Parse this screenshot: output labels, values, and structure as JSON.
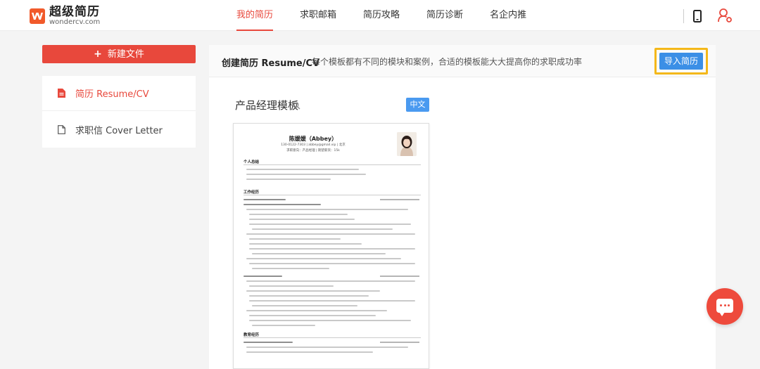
{
  "brand": {
    "title": "超级简历",
    "subtitle": "wondercv.com",
    "accent": "#e8483c",
    "logo_color": "#f15a2b"
  },
  "nav": {
    "items": [
      {
        "label": "我的简历",
        "active": true
      },
      {
        "label": "求职邮箱",
        "active": false
      },
      {
        "label": "简历攻略",
        "active": false
      },
      {
        "label": "简历诊断",
        "active": false
      },
      {
        "label": "名企内推",
        "active": false
      }
    ],
    "icons": [
      "phone-icon",
      "user-icon"
    ]
  },
  "sidebar": {
    "new_button": "新建文件",
    "items": [
      {
        "label": "简历 Resume/CV",
        "icon": "resume-file-icon",
        "active": true
      },
      {
        "label": "求职信 Cover Letter",
        "icon": "document-icon",
        "active": false
      }
    ]
  },
  "main": {
    "title": "创建简历 Resume/CV",
    "description": "每个模板都有不同的模块和案例，合适的模板能大大提高你的求职成功率",
    "import_button": "导入简历",
    "template_title": "产品经理模板",
    "lang_button": "中文",
    "import_color": "#3b8fe6",
    "highlight_color": "#f4b81a"
  },
  "resume": {
    "name": "陈媛媛（Abbey）",
    "contact": "130-0122-7303 | abbey@gmail.vip | 北京",
    "intent": "求职意向：产品经理 | 期望薪资：15k",
    "sections": [
      "个人总结",
      "工作经历",
      "教育经历"
    ]
  },
  "chat": {
    "icon": "chat-icon",
    "color": "#ee4a3c"
  }
}
